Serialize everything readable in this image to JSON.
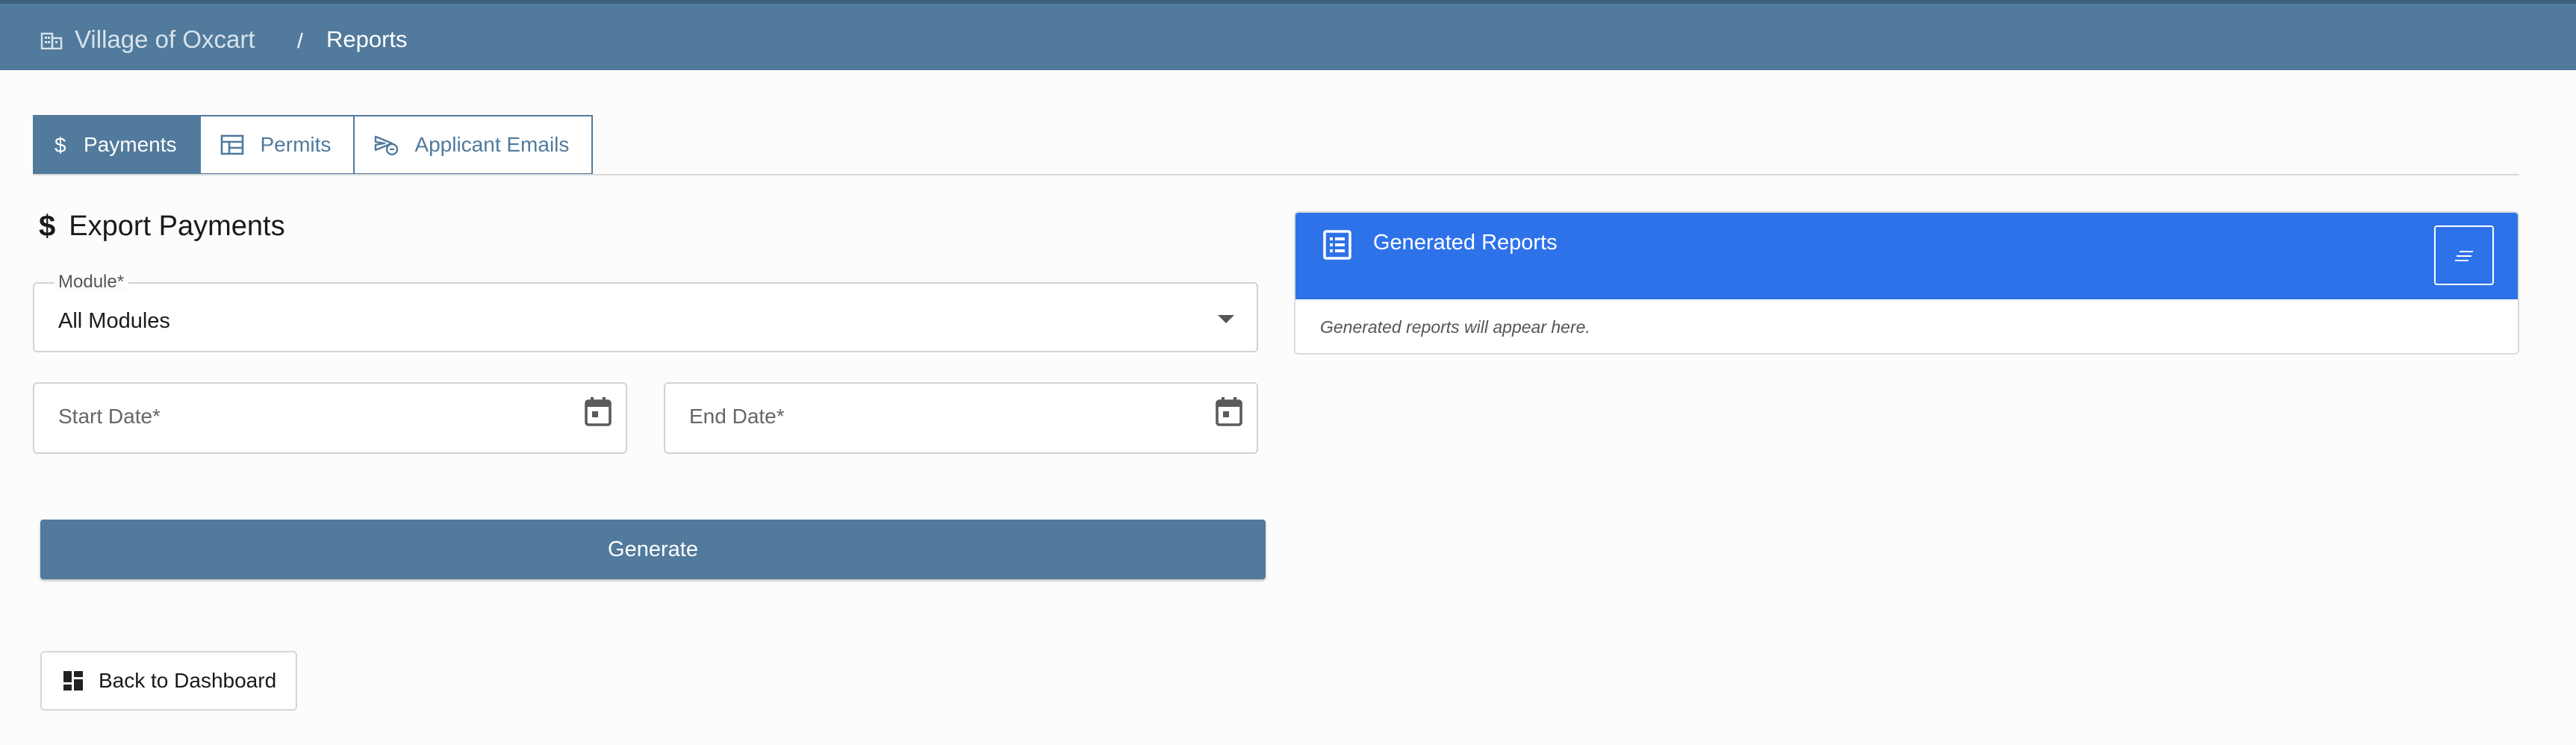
{
  "header": {
    "home_label": "Village of Oxcart",
    "separator": "/",
    "current_label": "Reports",
    "home_icon": "building-icon"
  },
  "tabs": [
    {
      "label": "Payments",
      "icon": "dollar-icon",
      "active": true
    },
    {
      "label": "Permits",
      "icon": "table-icon",
      "active": false
    },
    {
      "label": "Applicant Emails",
      "icon": "send-email-icon",
      "active": false
    }
  ],
  "export": {
    "title": "Export Payments",
    "title_icon": "dollar-icon",
    "module_label": "Module*",
    "module_value": "All Modules",
    "start_date_placeholder": "Start Date*",
    "end_date_placeholder": "End Date*",
    "generate_label": "Generate"
  },
  "back_button_label": "Back to Dashboard",
  "reports_panel": {
    "title": "Generated Reports",
    "empty_text": "Generated reports will appear here."
  },
  "colors": {
    "primary": "#517a9c",
    "panel_header": "#2e72ea",
    "background": "#fcfcfc"
  }
}
